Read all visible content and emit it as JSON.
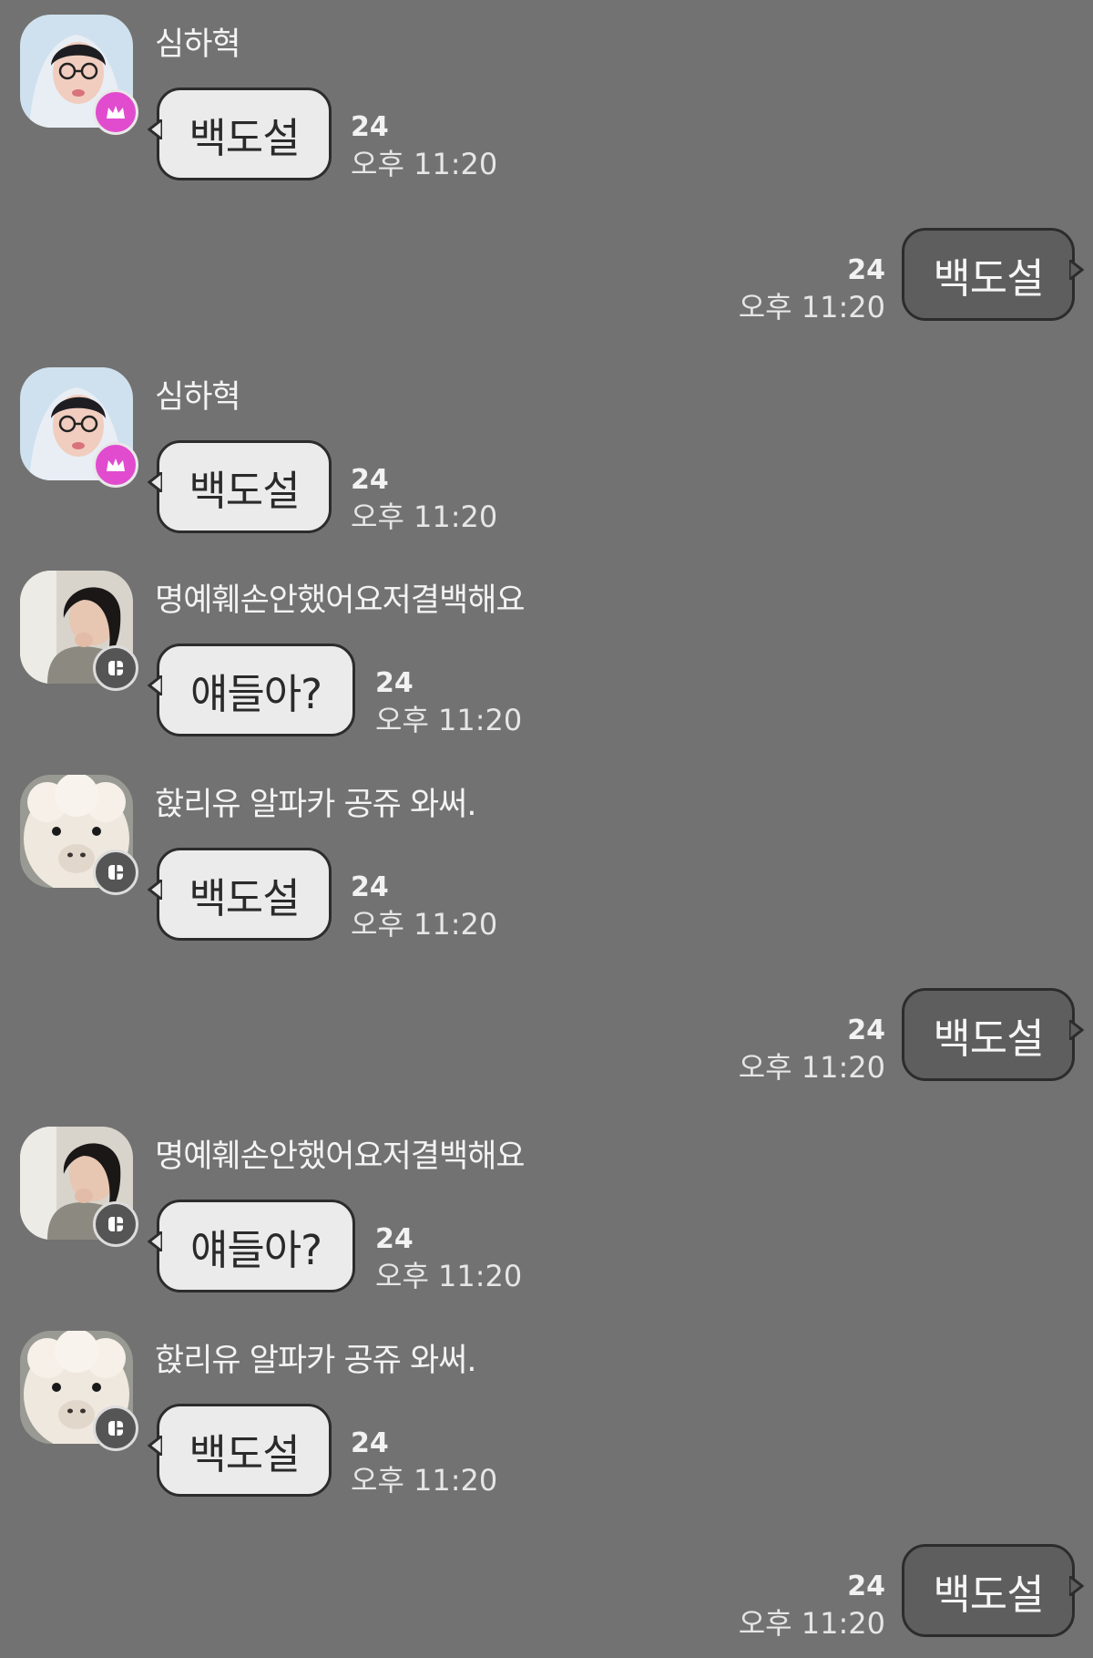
{
  "chat": {
    "messages": [
      {
        "side": "in",
        "sender": "심하혁",
        "avatar": "glasses-hood-avatar",
        "badge": "crown-icon",
        "text": "백도설",
        "count": "24",
        "time": "오후 11:20"
      },
      {
        "side": "out",
        "text": "백도설",
        "count": "24",
        "time": "오후 11:20"
      },
      {
        "side": "in",
        "sender": "심하혁",
        "avatar": "glasses-hood-avatar",
        "badge": "crown-icon",
        "text": "백도설",
        "count": "24",
        "time": "오후 11:20"
      },
      {
        "side": "in",
        "sender": "명예훼손안했어요저결백해요",
        "avatar": "girl-photo-avatar",
        "badge": "bot-icon",
        "text": "얘들아?",
        "count": "24",
        "time": "오후 11:20"
      },
      {
        "side": "in",
        "sender": "핝리유 알파카 공쥬 와써.",
        "avatar": "alpaca-avatar",
        "badge": "bot-icon",
        "text": "백도설",
        "count": "24",
        "time": "오후 11:20"
      },
      {
        "side": "out",
        "text": "백도설",
        "count": "24",
        "time": "오후 11:20"
      },
      {
        "side": "in",
        "sender": "명예훼손안했어요저결백해요",
        "avatar": "girl-photo-avatar",
        "badge": "bot-icon",
        "text": "얘들아?",
        "count": "24",
        "time": "오후 11:20"
      },
      {
        "side": "in",
        "sender": "핝리유 알파카 공쥬 와써.",
        "avatar": "alpaca-avatar",
        "badge": "bot-icon",
        "text": "백도설",
        "count": "24",
        "time": "오후 11:20"
      },
      {
        "side": "out",
        "text": "백도설",
        "count": "24",
        "time": "오후 11:20"
      }
    ]
  },
  "colors": {
    "background": "#727272",
    "incoming_bubble": "#ebebeb",
    "outgoing_bubble": "#5e5e5e",
    "crown_badge": "#e14ccf"
  }
}
